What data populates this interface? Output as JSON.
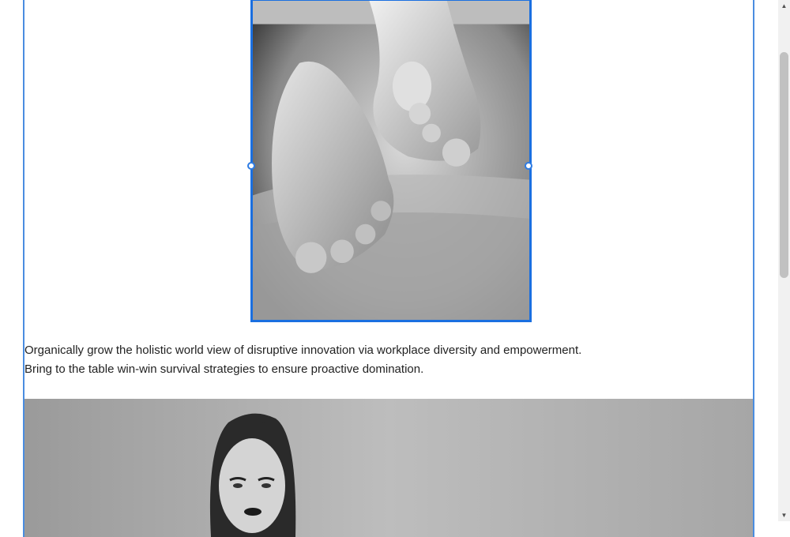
{
  "content": {
    "paragraph_lines": [
      "Organically grow the holistic world view of disruptive innovation via workplace diversity and empowerment.",
      "Bring to the table win-win survival strategies to ensure proactive domination."
    ]
  },
  "images": {
    "selected": {
      "subject": "baby-feet-photo",
      "selected": true
    },
    "wide": {
      "subject": "woman-portrait-photo"
    }
  },
  "colors": {
    "selection_border": "#1a6fe0",
    "frame_border": "#4a8de0",
    "text": "#222222"
  },
  "icons": {
    "scroll_up": "▲",
    "scroll_down": "▼"
  }
}
